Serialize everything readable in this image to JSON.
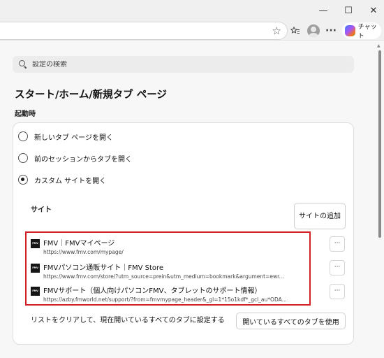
{
  "window": {
    "minimize_glyph": "—",
    "maximize_glyph": "☐",
    "close_glyph": "✕"
  },
  "toolbar": {
    "chat_label": "チャット",
    "icons": [
      "star-icon",
      "favorites-icon",
      "profile-icon",
      "more-icon",
      "copilot-icon"
    ],
    "more_glyph": "···"
  },
  "search": {
    "placeholder": "設定の検索",
    "value": ""
  },
  "page": {
    "title": "スタート/ホーム/新規タブ ページ",
    "section_label": "起動時"
  },
  "startup": {
    "options": [
      {
        "label": "新しいタブ ページを開く",
        "selected": false
      },
      {
        "label": "前のセッションからタブを開く",
        "selected": false
      },
      {
        "label": "カスタム サイトを開く",
        "selected": true
      }
    ]
  },
  "sites": {
    "label": "サイト",
    "add_button": "サイトの追加",
    "favicon_text": "FMV",
    "more_glyph": "···",
    "items": [
      {
        "name": "FMV｜FMVマイページ",
        "url": "https://www.fmv.com/mypage/"
      },
      {
        "name": "FMVパソコン通販サイト｜FMV Store",
        "url": "https://www.fmv.com/store/?utm_source=prein&utm_medium=bookmark&argument=ewr..."
      },
      {
        "name": "FMVサポート（個人向けパソコンFMV、タブレットのサポート情報）",
        "url": "https://azby.fmworld.net/support/?from=fmvmypage_header&_gl=1*15o1kdf*_gcl_au*ODA..."
      }
    ],
    "highlight_color": "#d21f26"
  },
  "clear": {
    "label": "リストをクリアして、現在開いているすべてのタブに設定する",
    "button": "開いているすべてのタブを使用"
  }
}
